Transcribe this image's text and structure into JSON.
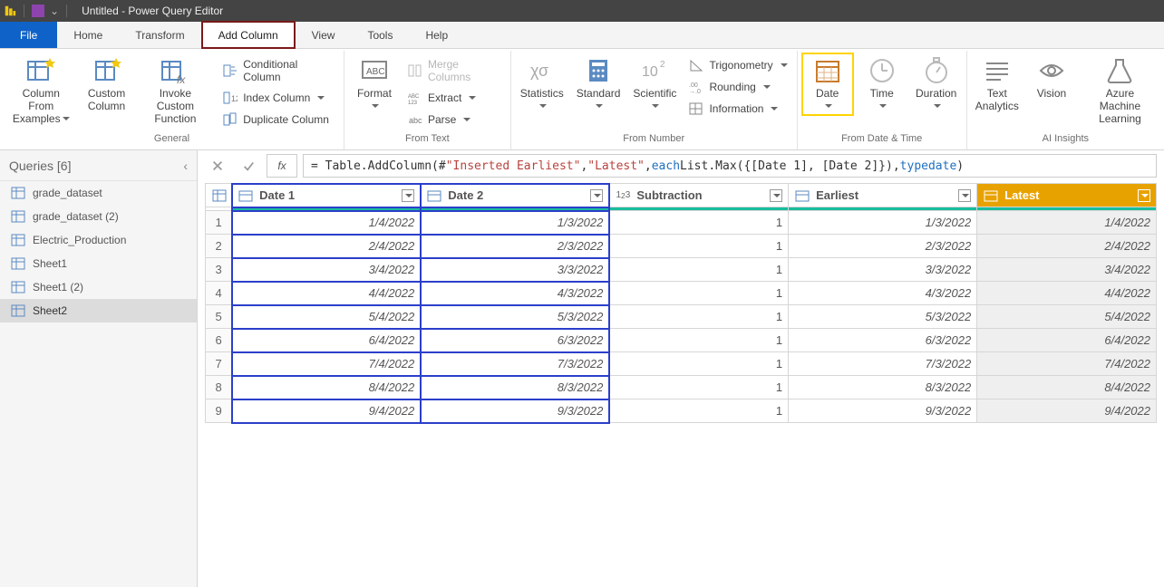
{
  "window": {
    "title": "Untitled - Power Query Editor"
  },
  "tabs": {
    "file": "File",
    "home": "Home",
    "transform": "Transform",
    "add_column": "Add Column",
    "view": "View",
    "tools": "Tools",
    "help": "Help"
  },
  "ribbon": {
    "general": {
      "caption": "General",
      "column_from_examples": "Column From\nExamples",
      "custom_column": "Custom\nColumn",
      "invoke_custom_function": "Invoke Custom\nFunction",
      "conditional_column": "Conditional Column",
      "index_column": "Index Column",
      "duplicate_column": "Duplicate Column"
    },
    "from_text": {
      "caption": "From Text",
      "format": "Format",
      "merge_columns": "Merge Columns",
      "extract": "Extract",
      "parse": "Parse"
    },
    "from_number": {
      "caption": "From Number",
      "statistics": "Statistics",
      "standard": "Standard",
      "scientific": "Scientific",
      "trigonometry": "Trigonometry",
      "rounding": "Rounding",
      "information": "Information"
    },
    "from_datetime": {
      "caption": "From Date & Time",
      "date": "Date",
      "time": "Time",
      "duration": "Duration"
    },
    "ai_insights": {
      "caption": "AI Insights",
      "text_analytics": "Text\nAnalytics",
      "vision": "Vision",
      "azure_ml": "Azure Machine\nLearning"
    }
  },
  "queries": {
    "heading": "Queries [6]",
    "items": [
      {
        "label": "grade_dataset"
      },
      {
        "label": "grade_dataset (2)"
      },
      {
        "label": "Electric_Production"
      },
      {
        "label": "Sheet1"
      },
      {
        "label": "Sheet1 (2)"
      },
      {
        "label": "Sheet2"
      }
    ]
  },
  "formula": {
    "prefix": "= Table.AddColumn(#",
    "arg1": "\"Inserted Earliest\"",
    "sep1": ", ",
    "arg2": "\"Latest\"",
    "mid": ", ",
    "each_kw": "each",
    "body": " List.Max({[Date 1], [Date 2]}), ",
    "type_kw": "type",
    "type_val": " date",
    "tail": ")"
  },
  "grid": {
    "headers": {
      "date1": "Date 1",
      "date2": "Date 2",
      "subtraction": "Subtraction",
      "earliest": "Earliest",
      "latest": "Latest"
    },
    "rows": [
      {
        "n": "1",
        "d1": "1/4/2022",
        "d2": "1/3/2022",
        "sub": "1",
        "ear": "1/3/2022",
        "lat": "1/4/2022"
      },
      {
        "n": "2",
        "d1": "2/4/2022",
        "d2": "2/3/2022",
        "sub": "1",
        "ear": "2/3/2022",
        "lat": "2/4/2022"
      },
      {
        "n": "3",
        "d1": "3/4/2022",
        "d2": "3/3/2022",
        "sub": "1",
        "ear": "3/3/2022",
        "lat": "3/4/2022"
      },
      {
        "n": "4",
        "d1": "4/4/2022",
        "d2": "4/3/2022",
        "sub": "1",
        "ear": "4/3/2022",
        "lat": "4/4/2022"
      },
      {
        "n": "5",
        "d1": "5/4/2022",
        "d2": "5/3/2022",
        "sub": "1",
        "ear": "5/3/2022",
        "lat": "5/4/2022"
      },
      {
        "n": "6",
        "d1": "6/4/2022",
        "d2": "6/3/2022",
        "sub": "1",
        "ear": "6/3/2022",
        "lat": "6/4/2022"
      },
      {
        "n": "7",
        "d1": "7/4/2022",
        "d2": "7/3/2022",
        "sub": "1",
        "ear": "7/3/2022",
        "lat": "7/4/2022"
      },
      {
        "n": "8",
        "d1": "8/4/2022",
        "d2": "8/3/2022",
        "sub": "1",
        "ear": "8/3/2022",
        "lat": "8/4/2022"
      },
      {
        "n": "9",
        "d1": "9/4/2022",
        "d2": "9/3/2022",
        "sub": "1",
        "ear": "9/3/2022",
        "lat": "9/4/2022"
      }
    ]
  },
  "fx_label": "fx"
}
